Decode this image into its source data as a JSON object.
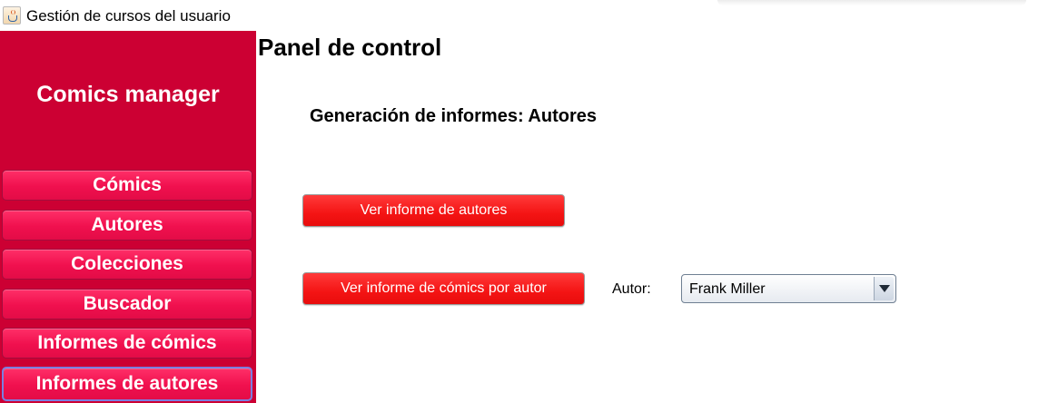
{
  "window": {
    "title": "Gestión de cursos del usuario",
    "icon": "java-cup-icon"
  },
  "sidebar": {
    "app_name": "Comics manager",
    "items": [
      {
        "label": "Cómics"
      },
      {
        "label": "Autores"
      },
      {
        "label": "Colecciones"
      },
      {
        "label": "Buscador"
      },
      {
        "label": "Informes de cómics"
      },
      {
        "label": "Informes de autores",
        "active": true
      }
    ]
  },
  "main": {
    "title": "Panel de control",
    "section_title": "Generación de informes: Autores",
    "buttons": {
      "authors_report": "Ver informe de autores",
      "comics_by_author_report": "Ver informe de cómics por autor"
    },
    "author_label": "Autor:",
    "author_select": {
      "value": "Frank Miller"
    }
  },
  "colors": {
    "sidebar_bg": "#cc0033",
    "nav_button": "#f0104e",
    "action_button": "#f41414",
    "active_border": "#7a7fe0"
  }
}
